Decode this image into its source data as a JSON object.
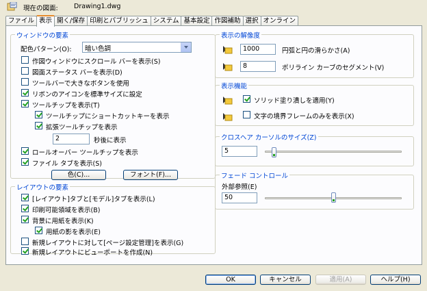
{
  "header": {
    "label": "現在の図面:",
    "filename": "Drawing1.dwg"
  },
  "tabs": [
    {
      "label": "ファイル",
      "active": false
    },
    {
      "label": "表示",
      "active": true
    },
    {
      "label": "開く/保存",
      "active": false
    },
    {
      "label": "印刷とパブリッシュ",
      "active": false
    },
    {
      "label": "システム",
      "active": false
    },
    {
      "label": "基本設定",
      "active": false
    },
    {
      "label": "作図補助",
      "active": false
    },
    {
      "label": "選択",
      "active": false
    },
    {
      "label": "オンライン",
      "active": false
    }
  ],
  "window_elements": {
    "title": "ウィンドウの要素",
    "color_scheme_label": "配色パターン(O):",
    "color_scheme_value": "暗い色調",
    "checkboxes": [
      {
        "label": "作図ウィンドウにスクロール バーを表示(S)",
        "checked": false
      },
      {
        "label": "図面ステータス バーを表示(D)",
        "checked": false
      },
      {
        "label": "ツールバーで大きなボタンを使用",
        "checked": false
      },
      {
        "label": "リボンのアイコンを標準サイズに設定",
        "checked": true
      },
      {
        "label": "ツールチップを表示(T)",
        "checked": true
      },
      {
        "label": "ツールチップにショートカットキーを表示",
        "checked": true
      },
      {
        "label": "拡張ツールチップを表示",
        "checked": true
      }
    ],
    "delay_value": "2",
    "delay_label": "秒後に表示",
    "checkboxes2": [
      {
        "label": "ロールオーバー ツールチップを表示",
        "checked": true
      },
      {
        "label": "ファイル タブを表示(S)",
        "checked": true
      }
    ],
    "color_button": "色(C)...",
    "font_button": "フォント(F)..."
  },
  "layout_elements": {
    "title": "レイアウトの要素",
    "checkboxes": [
      {
        "label": "[レイアウト]タブと[モデル]タブを表示(L)",
        "checked": true
      },
      {
        "label": "印刷可能領域を表示(B)",
        "checked": true
      },
      {
        "label": "背景に用紙を表示(K)",
        "checked": true
      },
      {
        "label": "用紙の影を表示(E)",
        "checked": true
      },
      {
        "label": "新規レイアウトに対して[ページ設定管理]を表示(G)",
        "checked": false
      },
      {
        "label": "新規レイアウトにビューポートを作成(N)",
        "checked": true
      }
    ]
  },
  "resolution": {
    "title": "表示の解像度",
    "arc_value": "1000",
    "arc_label": "円弧と円の滑らかさ(A)",
    "polyline_value": "8",
    "polyline_label": "ポリライン カーブのセグメント(V)"
  },
  "performance": {
    "title": "表示機能",
    "checkboxes": [
      {
        "label": "ソリッド塗り潰しを適用(Y)",
        "checked": true
      },
      {
        "label": "文字の境界フレームのみを表示(X)",
        "checked": false
      }
    ]
  },
  "crosshair": {
    "title": "クロスヘア カーソルのサイズ(Z)",
    "value": "5",
    "slider_fraction": 0.05
  },
  "fade": {
    "title": "フェード コントロール",
    "label": "外部参照(E)",
    "value": "50",
    "slider_fraction": 0.5
  },
  "buttons": {
    "ok": "OK",
    "cancel": "キャンセル",
    "apply": "適用(A)",
    "help": "ヘルプ(H)"
  },
  "colors": {
    "group_title": "#0046d5",
    "tab_highlight": "#e68b2c",
    "check": "#21a121"
  }
}
